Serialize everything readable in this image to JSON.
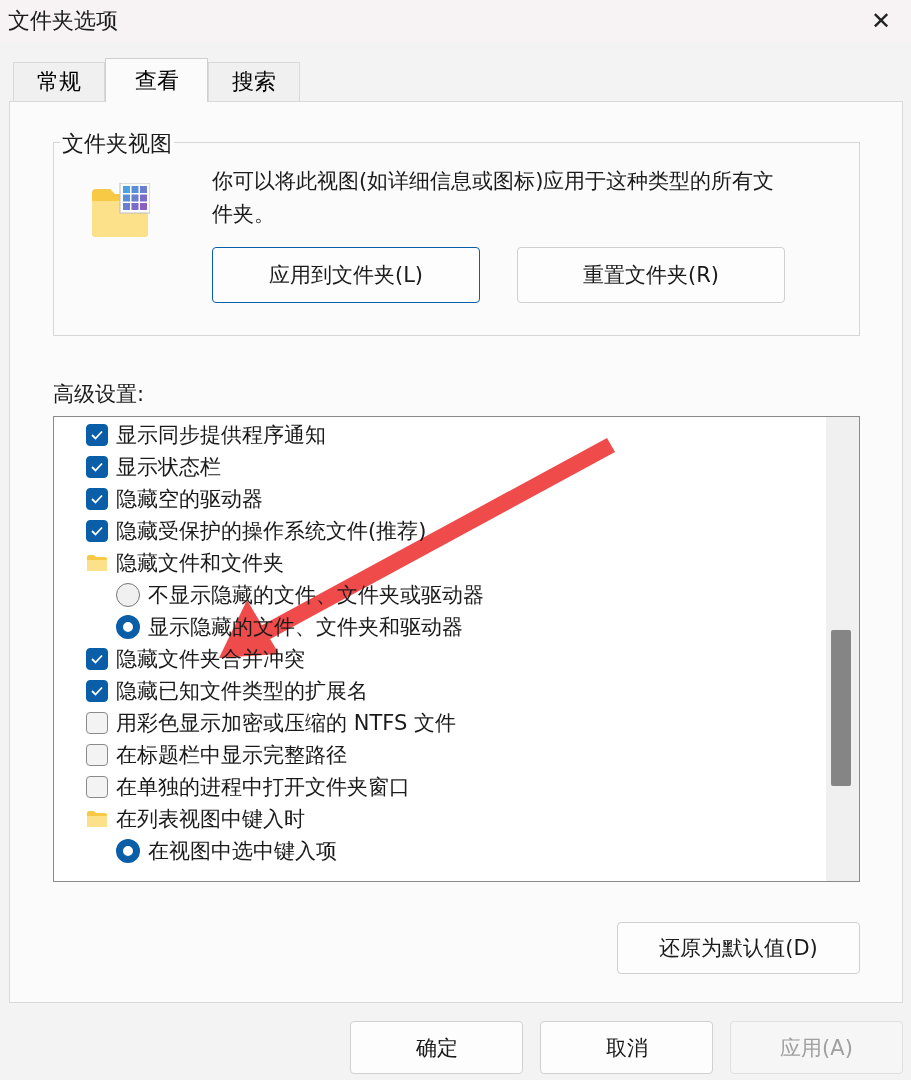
{
  "window": {
    "title": "文件夹选项",
    "close": "✕"
  },
  "tabs": [
    {
      "label": "常规",
      "selected": false
    },
    {
      "label": "查看",
      "selected": true
    },
    {
      "label": "搜索",
      "selected": false
    }
  ],
  "folder_views": {
    "title": "文件夹视图",
    "description": "你可以将此视图(如详细信息或图标)应用于这种类型的所有文件夹。",
    "buttons": [
      {
        "label": "应用到文件夹(L)",
        "focused": true
      },
      {
        "label": "重置文件夹(R)",
        "focused": false
      }
    ]
  },
  "advanced": {
    "label": "高级设置:",
    "items": [
      {
        "kind": "checkbox",
        "label": "显示同步提供程序通知",
        "checked": true
      },
      {
        "kind": "checkbox",
        "label": "显示状态栏",
        "checked": true
      },
      {
        "kind": "checkbox",
        "label": "隐藏空的驱动器",
        "checked": true
      },
      {
        "kind": "checkbox",
        "label": "隐藏受保护的操作系统文件(推荐)",
        "checked": true
      },
      {
        "kind": "folder",
        "label": "隐藏文件和文件夹"
      },
      {
        "kind": "radio",
        "label": "不显示隐藏的文件、文件夹或驱动器",
        "selected": false
      },
      {
        "kind": "radio",
        "label": "显示隐藏的文件、文件夹和驱动器",
        "selected": true
      },
      {
        "kind": "checkbox",
        "label": "隐藏文件夹合并冲突",
        "checked": true
      },
      {
        "kind": "checkbox",
        "label": "隐藏已知文件类型的扩展名",
        "checked": true
      },
      {
        "kind": "checkbox",
        "label": "用彩色显示加密或压缩的 NTFS 文件",
        "checked": false
      },
      {
        "kind": "checkbox",
        "label": "在标题栏中显示完整路径",
        "checked": false
      },
      {
        "kind": "checkbox",
        "label": "在单独的进程中打开文件夹窗口",
        "checked": false
      },
      {
        "kind": "folder",
        "label": "在列表视图中键入时"
      },
      {
        "kind": "radio",
        "label": "在视图中选中键入项",
        "selected": true
      }
    ],
    "restore_button": "还原为默认值(D)"
  },
  "buttons": [
    {
      "label": "确定",
      "disabled": false
    },
    {
      "label": "取消",
      "disabled": false
    },
    {
      "label": "应用(A)",
      "disabled": true
    }
  ]
}
